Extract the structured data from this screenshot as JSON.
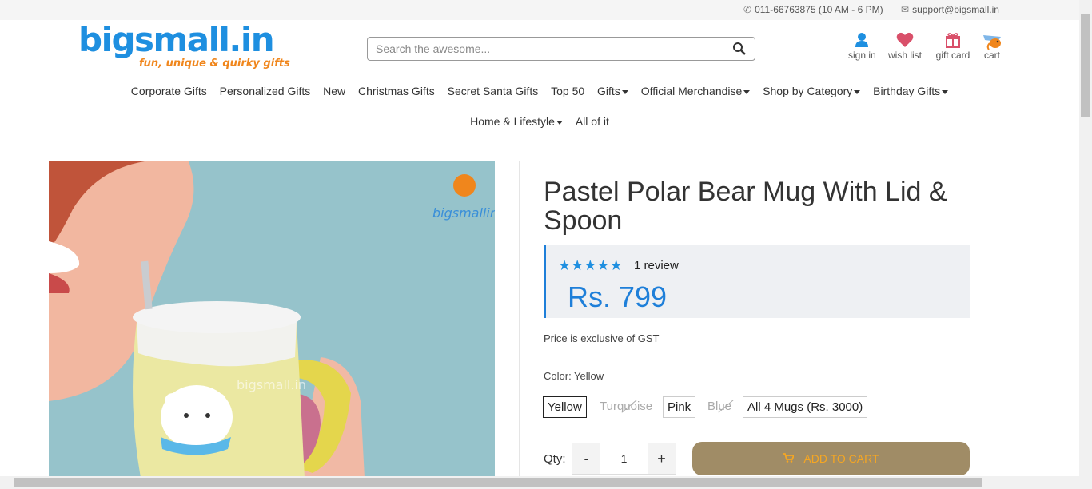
{
  "topbar": {
    "phone": "011-66763875 (10 AM - 6 PM)",
    "email": "support@bigsmall.in"
  },
  "logo": {
    "name": "bigsmall.in",
    "tagline": "fun, unique & quirky gifts"
  },
  "search": {
    "placeholder": "Search the awesome..."
  },
  "header_icons": [
    {
      "label": "sign in",
      "icon": "user-icon"
    },
    {
      "label": "wish list",
      "icon": "heart-icon"
    },
    {
      "label": "gift card",
      "icon": "gift-icon"
    },
    {
      "label": "cart",
      "icon": "cart-icon"
    }
  ],
  "nav": {
    "row1": [
      "Corporate Gifts",
      "Personalized Gifts",
      "New",
      "Christmas Gifts",
      "Secret Santa Gifts",
      "Top 50",
      "Gifts",
      "Official Merchandise",
      "Shop by Category",
      "Birthday Gifts"
    ],
    "row2": [
      "Home & Lifestyle",
      "All of it"
    ]
  },
  "product": {
    "title": "Pastel Polar Bear Mug With Lid & Spoon",
    "rating_stars": 5,
    "reviews": "1 review",
    "price": "Rs. 799",
    "gst_note": "Price is exclusive of GST",
    "color_label": "Color: Yellow",
    "variants": [
      {
        "label": "Yellow",
        "state": "selected"
      },
      {
        "label": "Turquoise",
        "state": "unavailable"
      },
      {
        "label": "Pink",
        "state": "available"
      },
      {
        "label": "Blue",
        "state": "unavailable"
      },
      {
        "label": "All 4 Mugs (Rs. 3000)",
        "state": "available"
      }
    ],
    "qty_label": "Qty:",
    "qty_value": "1",
    "minus": "-",
    "plus": "+",
    "add_to_cart": "ADD TO CART",
    "image_watermark": "bigsmall.in",
    "image_logo_text": "bigsmallin"
  },
  "colors": {
    "brand_blue": "#1e8fe0",
    "brand_orange": "#f0861c",
    "cart_button": "#a08c66",
    "price_blue": "#1e7fd9"
  }
}
